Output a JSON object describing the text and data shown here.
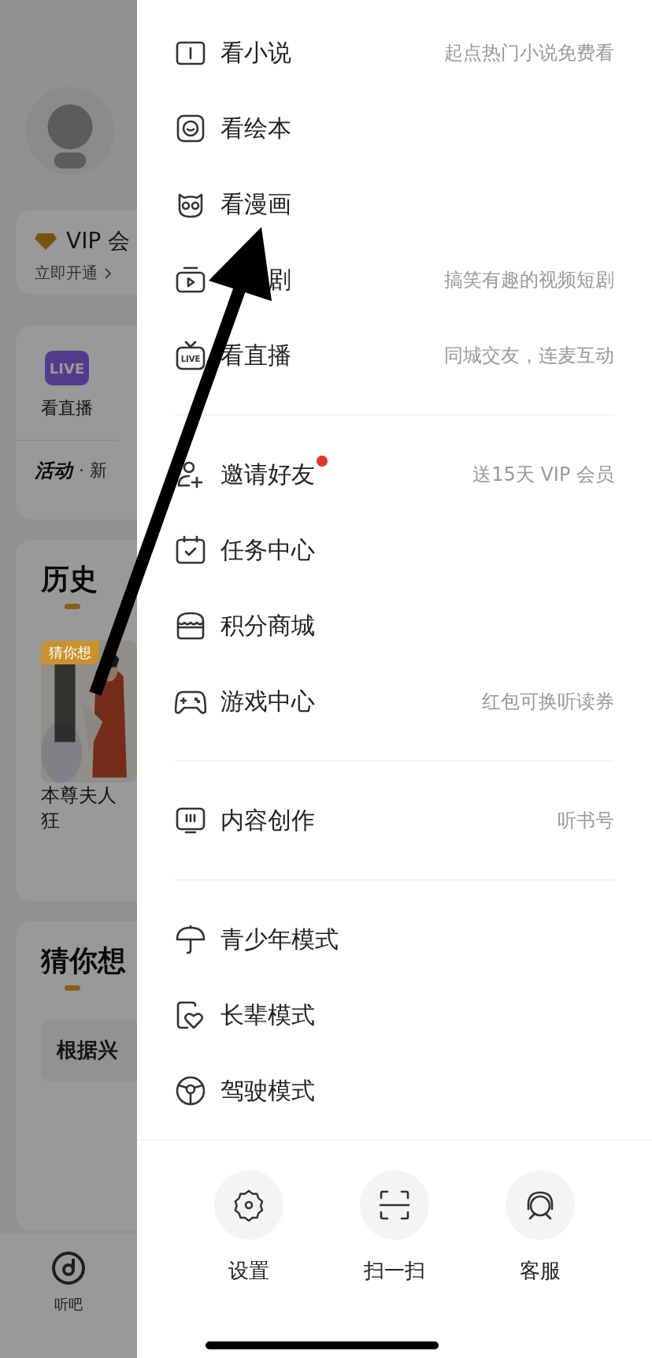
{
  "background": {
    "vip": {
      "title": "VIP 会",
      "action": "立即开通"
    },
    "shortcut": {
      "badge": "LIVE",
      "label": "看直播"
    },
    "activity": {
      "tag": "活动",
      "text": "· 新"
    },
    "history": {
      "title": "历史",
      "book": {
        "badge": "猜你想",
        "title_lines": [
          "本尊夫人",
          "狂"
        ]
      }
    },
    "guess": {
      "title": "猜你想",
      "chip": "根据兴"
    },
    "tabbar": [
      {
        "label": "听吧"
      }
    ]
  },
  "menu": {
    "groups": [
      {
        "items": [
          {
            "label": "看小说",
            "hint": "起点热门小说免费看",
            "dot": false
          },
          {
            "label": "看绘本",
            "dot": false
          },
          {
            "label": "看漫画",
            "dot": false
          },
          {
            "label": "剧",
            "covered": true,
            "hint": "搞笑有趣的视频短剧",
            "dot": false
          },
          {
            "label": "看直播",
            "icon_text": "LIVE",
            "hint": "同城交友，连麦互动",
            "dot": false
          }
        ]
      },
      {
        "items": [
          {
            "label": "邀请好友",
            "hint": "送15天 VIP 会员",
            "dot": true
          },
          {
            "label": "任务中心",
            "dot": false
          },
          {
            "label": "积分商城",
            "dot": false
          },
          {
            "label": "游戏中心",
            "hint": "红包可换听读券",
            "dot": false
          }
        ]
      },
      {
        "items": [
          {
            "label": "内容创作",
            "hint": "听书号",
            "dot": false
          }
        ]
      },
      {
        "items": [
          {
            "label": "青少年模式",
            "dot": false
          },
          {
            "label": "长辈模式",
            "dot": false
          },
          {
            "label": "驾驶模式",
            "dot": false
          }
        ]
      }
    ],
    "actions": [
      {
        "label": "设置"
      },
      {
        "label": "扫一扫"
      },
      {
        "label": "客服"
      }
    ]
  },
  "annotation": {
    "kind": "arrow"
  }
}
